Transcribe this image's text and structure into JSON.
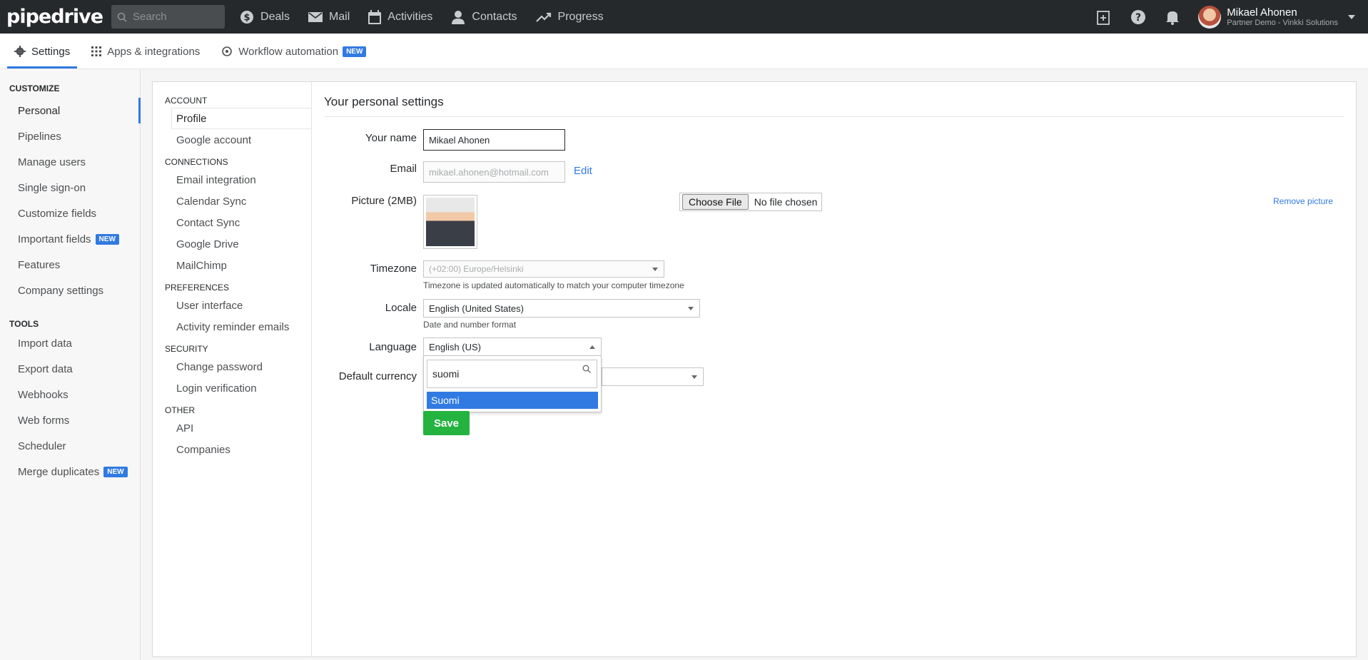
{
  "topbar": {
    "logo": "pipedrive",
    "search_placeholder": "Search",
    "nav": [
      {
        "label": "Deals",
        "icon": "dollar-icon"
      },
      {
        "label": "Mail",
        "icon": "mail-icon"
      },
      {
        "label": "Activities",
        "icon": "calendar-icon"
      },
      {
        "label": "Contacts",
        "icon": "person-icon"
      },
      {
        "label": "Progress",
        "icon": "trend-icon"
      }
    ],
    "user_name": "Mikael Ahonen",
    "user_org": "Partner Demo - Vinkki Solutions"
  },
  "subnav": {
    "settings": "Settings",
    "apps": "Apps & integrations",
    "workflow": "Workflow automation",
    "workflow_badge": "NEW"
  },
  "left": {
    "customize_title": "CUSTOMIZE",
    "customize": [
      "Personal",
      "Pipelines",
      "Manage users",
      "Single sign-on",
      "Customize fields",
      "Important fields",
      "Features",
      "Company settings"
    ],
    "important_badge": "NEW",
    "tools_title": "TOOLS",
    "tools": [
      "Import data",
      "Export data",
      "Webhooks",
      "Web forms",
      "Scheduler",
      "Merge duplicates"
    ],
    "merge_badge": "NEW"
  },
  "mid": {
    "account_title": "ACCOUNT",
    "account": [
      "Profile",
      "Google account"
    ],
    "connections_title": "CONNECTIONS",
    "connections": [
      "Email integration",
      "Calendar Sync",
      "Contact Sync",
      "Google Drive",
      "MailChimp"
    ],
    "preferences_title": "PREFERENCES",
    "preferences": [
      "User interface",
      "Activity reminder emails"
    ],
    "security_title": "SECURITY",
    "security": [
      "Change password",
      "Login verification"
    ],
    "other_title": "OTHER",
    "other": [
      "API",
      "Companies"
    ]
  },
  "form": {
    "title": "Your personal settings",
    "name_label": "Your name",
    "name_value": "Mikael Ahonen",
    "email_label": "Email",
    "email_value": "mikael.ahonen@hotmail.com",
    "email_edit": "Edit",
    "picture_label": "Picture (2MB)",
    "choose_file": "Choose File",
    "no_file": "No file chosen",
    "remove_picture": "Remove picture",
    "timezone_label": "Timezone",
    "timezone_value": "(+02:00) Europe/Helsinki",
    "timezone_hint": "Timezone is updated automatically to match your computer timezone",
    "locale_label": "Locale",
    "locale_value": "English (United States)",
    "locale_hint": "Date and number format",
    "language_label": "Language",
    "language_value": "English (US)",
    "language_search": "suomi",
    "language_option": "Suomi",
    "currency_label": "Default currency",
    "save": "Save"
  }
}
